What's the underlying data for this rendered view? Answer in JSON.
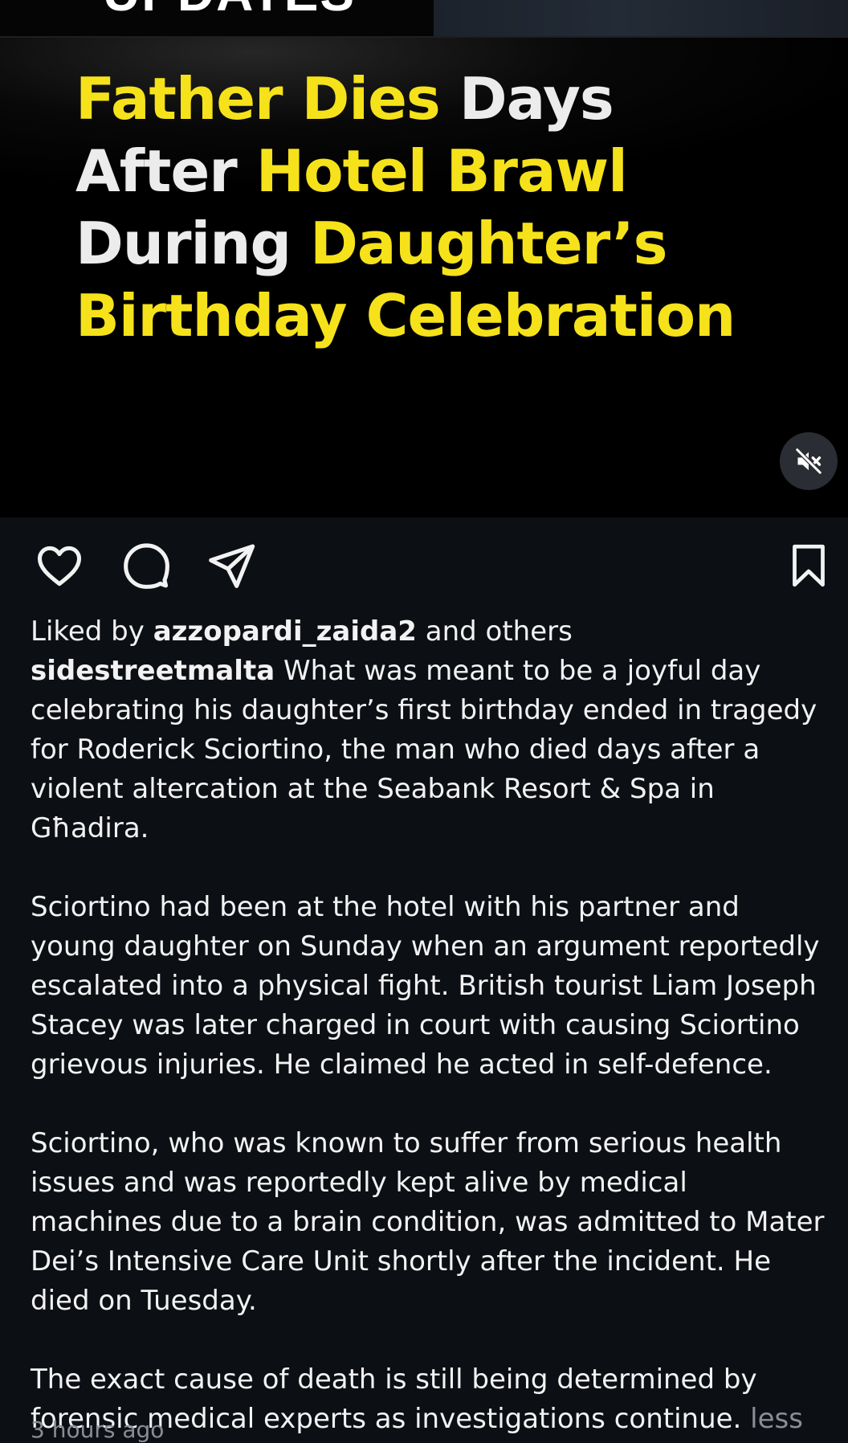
{
  "media": {
    "cut_label": "UPDATES",
    "headline": [
      [
        {
          "text": "Father Dies ",
          "color": "yellow"
        },
        {
          "text": "Days",
          "color": "white"
        }
      ],
      [
        {
          "text": "After ",
          "color": "white"
        },
        {
          "text": "Hotel Brawl",
          "color": "yellow"
        }
      ],
      [
        {
          "text": "During ",
          "color": "white"
        },
        {
          "text": "Daughter’s",
          "color": "yellow"
        }
      ],
      [
        {
          "text": "Birthday Celebration",
          "color": "yellow"
        }
      ]
    ],
    "mute_icon": "speaker-muted-icon"
  },
  "actions": {
    "like_icon": "heart-icon",
    "comment_icon": "comment-icon",
    "share_icon": "paper-plane-icon",
    "save_icon": "bookmark-icon"
  },
  "likes": {
    "prefix": "Liked by ",
    "user": "azzopardi_zaida2",
    "suffix": " and others"
  },
  "caption": {
    "username": "sidestreetmalta",
    "paragraphs": [
      " What was meant to be a joyful day celebrating his daughter’s first birthday ended in tragedy for Roderick Sciortino, the man who died days after a violent altercation at the Seabank Resort & Spa in Għadira.",
      "Sciortino had been at the hotel with his partner and young daughter on Sunday when an argument reportedly escalated into a physical fight. British tourist Liam Joseph Stacey was later charged in court with causing Sciortino grievous injuries. He claimed he acted in self-defence.",
      "Sciortino, who was known to suffer from serious health issues and was reportedly kept alive by medical machines due to a brain condition, was admitted to Mater Dei’s Intensive Care Unit shortly after the incident. He died on Tuesday.",
      "The exact cause of death is still being determined by forensic medical experts as investigations continue."
    ],
    "less_label": "less"
  },
  "timestamp": "3 hours ago",
  "colors": {
    "headline_yellow": "#f6e21a",
    "headline_white": "#ececec",
    "background": "#0c0f14",
    "muted_text": "#8a8e94"
  }
}
